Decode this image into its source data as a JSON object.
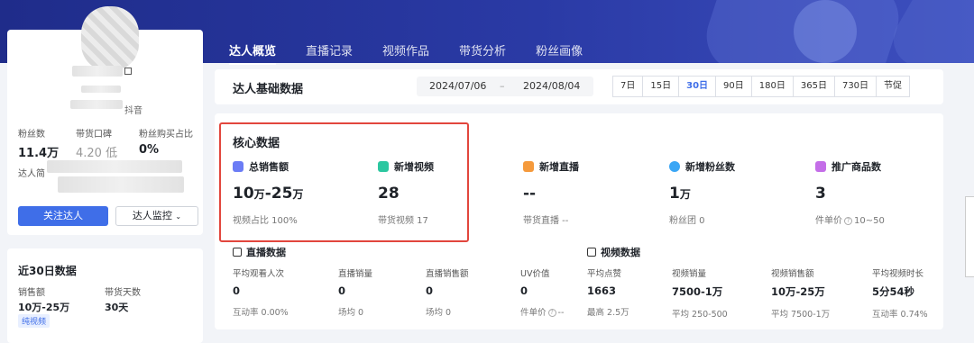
{
  "tabs": [
    "达人概览",
    "直播记录",
    "视频作品",
    "带货分析",
    "粉丝画像"
  ],
  "profile": {
    "platform_tag": "抖音",
    "stats": [
      {
        "label": "粉丝数",
        "value": "11.4万"
      },
      {
        "label": "带货口碑",
        "value": "4.20 低"
      },
      {
        "label": "粉丝购买占比",
        "value": "0%"
      }
    ],
    "daren_label": "达人简",
    "follow_label": "关注达人",
    "monitor_label": "达人监控"
  },
  "recent30": {
    "title": "近30日数据",
    "sales_label": "销售额",
    "sales_value": "10万-25万",
    "days_label": "带货天数",
    "days_value": "30天",
    "tag": "纯视频"
  },
  "datebar": {
    "title": "达人基础数据",
    "start": "2024/07/06",
    "sep": "–",
    "end": "2024/08/04",
    "periods": [
      "7日",
      "15日",
      "30日",
      "90日",
      "180日",
      "365日",
      "730日",
      "节促"
    ],
    "active_period": "30日"
  },
  "core": {
    "title": "核心数据",
    "metrics": [
      {
        "label": "总销售额",
        "value_a": "10",
        "unit_a": "万",
        "sep": "-",
        "value_b": "25",
        "unit_b": "万",
        "sub": "视频占比 100%",
        "icon": "sales-icon",
        "color": "#6b7cf5"
      },
      {
        "label": "新增视频",
        "value": "28",
        "sub": "带货视频 17",
        "icon": "video-icon",
        "color": "#2cc7a0"
      },
      {
        "label": "新增直播",
        "value": "--",
        "sub": "带货直播 --",
        "icon": "live-icon",
        "color": "#f59a3c"
      },
      {
        "label": "新增粉丝数",
        "value": "1",
        "unit": "万",
        "sub": "粉丝团 0",
        "icon": "fans-icon",
        "color": "#3aa6f5"
      },
      {
        "label": "推广商品数",
        "value": "3",
        "sub_prefix": "件单价",
        "sub_value": "10~50",
        "icon": "goods-icon",
        "color": "#c46ee8"
      }
    ]
  },
  "live": {
    "title": "直播数据",
    "cells": [
      {
        "label": "平均观看人次",
        "value": "0",
        "sub": "互动率 0.00%"
      },
      {
        "label": "直播销量",
        "value": "0",
        "sub": "场均 0"
      },
      {
        "label": "直播销售额",
        "value": "0",
        "sub": "场均 0"
      },
      {
        "label": "UV价值",
        "value": "0",
        "sub_prefix": "件单价",
        "sub_value": "--"
      }
    ]
  },
  "video": {
    "title": "视频数据",
    "cells": [
      {
        "label": "平均点赞",
        "value": "1663",
        "sub": "最高 2.5万"
      },
      {
        "label": "视频销量",
        "value": "7500-1万",
        "sub": "平均 250-500"
      },
      {
        "label": "视频销售额",
        "value": "10万-25万",
        "sub": "平均 7500-1万"
      },
      {
        "label": "平均视频时长",
        "value": "5分54秒",
        "sub": "互动率 0.74%"
      }
    ]
  }
}
